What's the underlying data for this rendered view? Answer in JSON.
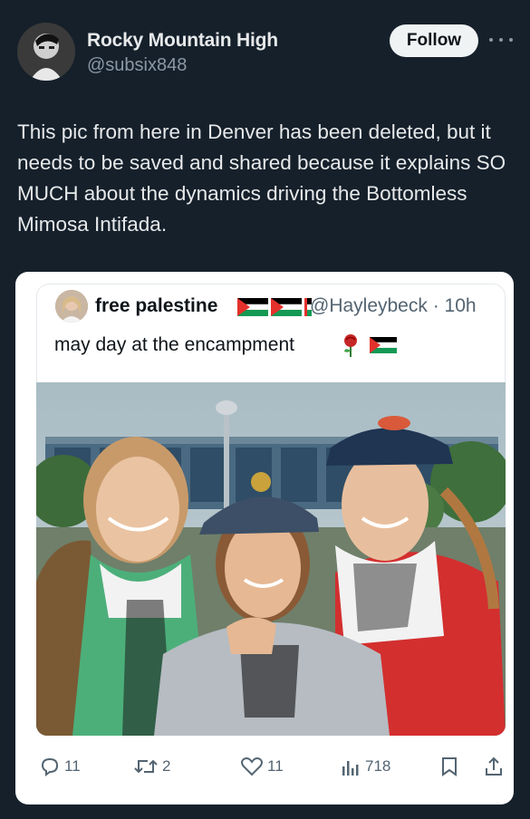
{
  "author": {
    "name": "Rocky Mountain High",
    "handle": "@subsix848",
    "follow_label": "Follow"
  },
  "tweet": {
    "text": "This pic from here in Denver has been deleted, but it needs to be saved and shared because it explains SO MUCH about the dynamics driving the Bottomless Mimosa Intifada."
  },
  "quoted": {
    "name": "free palestine",
    "handle_time": "@Hayleybeck · 10h",
    "text": "may day at the encampment"
  },
  "actions": {
    "replies": "11",
    "reposts": "2",
    "likes": "11",
    "views": "718"
  },
  "icons": [
    "reply-icon",
    "repost-icon",
    "like-icon",
    "views-icon",
    "bookmark-icon",
    "share-icon",
    "more-icon"
  ],
  "colors": {
    "background": "#15202b",
    "card": "#ffffff",
    "secondary_text": "#8b98a5",
    "flag_green": "#149954",
    "flag_red": "#e4312b"
  }
}
